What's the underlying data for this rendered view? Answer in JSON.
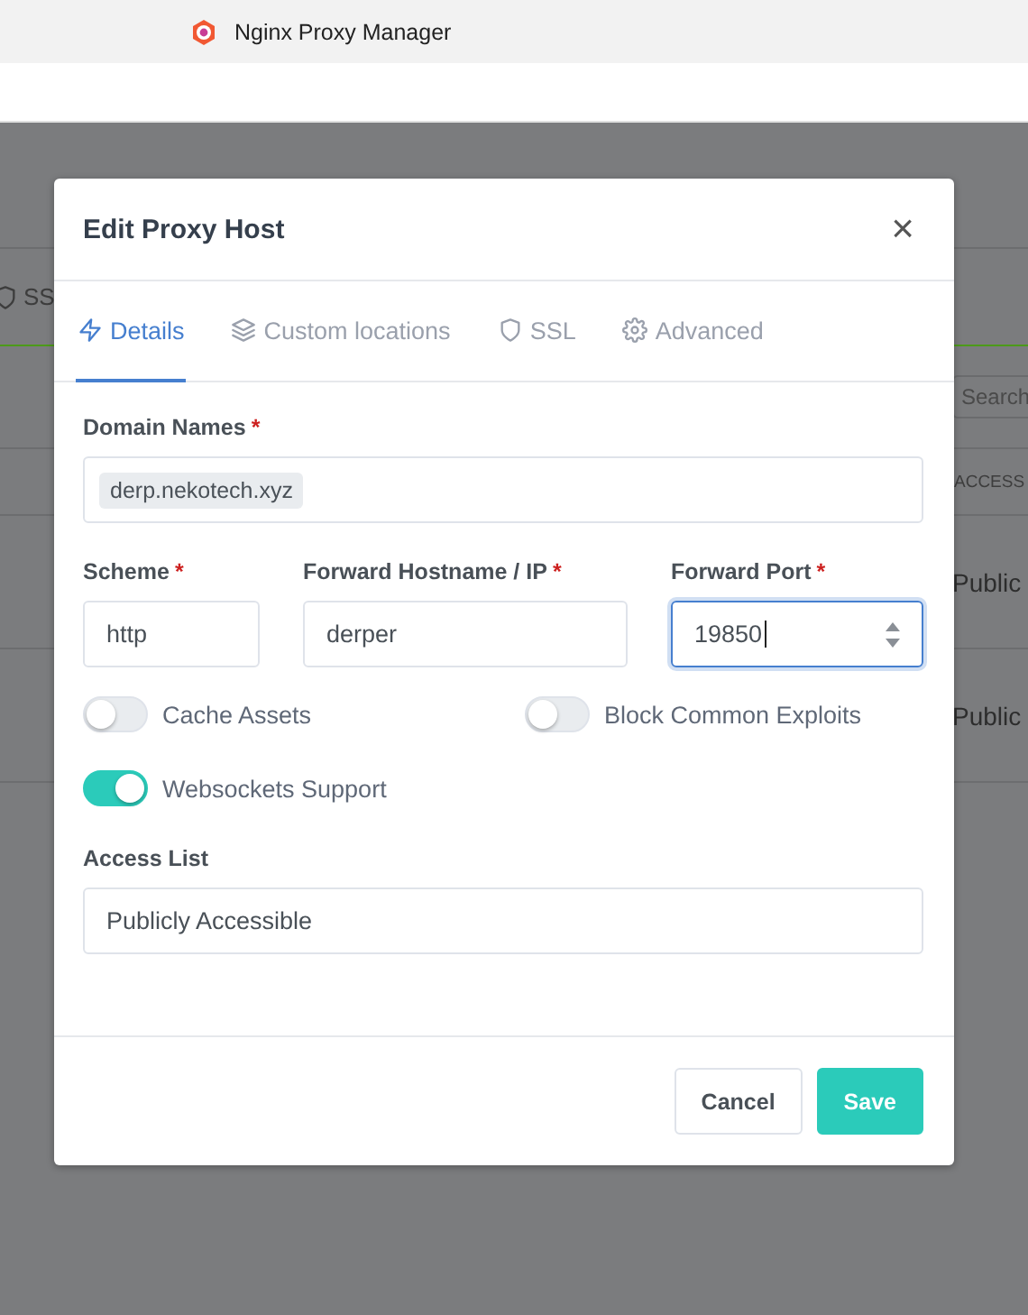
{
  "browser_tab": {
    "title": "Nginx Proxy Manager"
  },
  "background": {
    "tab_label": "SS",
    "search_placeholder": "Search",
    "column_header": "ACCESS",
    "rows": [
      "Public",
      "Public"
    ]
  },
  "modal": {
    "title": "Edit Proxy Host",
    "close": "×",
    "tabs": [
      {
        "label": "Details",
        "selected": true
      },
      {
        "label": "Custom locations",
        "selected": false
      },
      {
        "label": "SSL",
        "selected": false
      },
      {
        "label": "Advanced",
        "selected": false
      }
    ],
    "domain_names": {
      "label": "Domain Names",
      "required_mark": "*",
      "tags": [
        "derp.nekotech.xyz"
      ]
    },
    "fields": [
      {
        "label": "Scheme",
        "required_mark": "*",
        "value": "http",
        "focused": false,
        "kind": "text"
      },
      {
        "label": "Forward Hostname / IP",
        "required_mark": "*",
        "value": "derper",
        "focused": false,
        "kind": "text"
      },
      {
        "label": "Forward Port",
        "required_mark": "*",
        "value": "19850",
        "focused": true,
        "kind": "number"
      }
    ],
    "toggles": [
      {
        "label": "Cache Assets",
        "on": false
      },
      {
        "label": "Block Common Exploits",
        "on": false
      },
      {
        "label": "Websockets Support",
        "on": true
      }
    ],
    "access_list": {
      "label": "Access List",
      "value": "Publicly Accessible"
    },
    "buttons": [
      {
        "label": "Cancel",
        "kind": "secondary"
      },
      {
        "label": "Save",
        "kind": "primary"
      }
    ]
  }
}
